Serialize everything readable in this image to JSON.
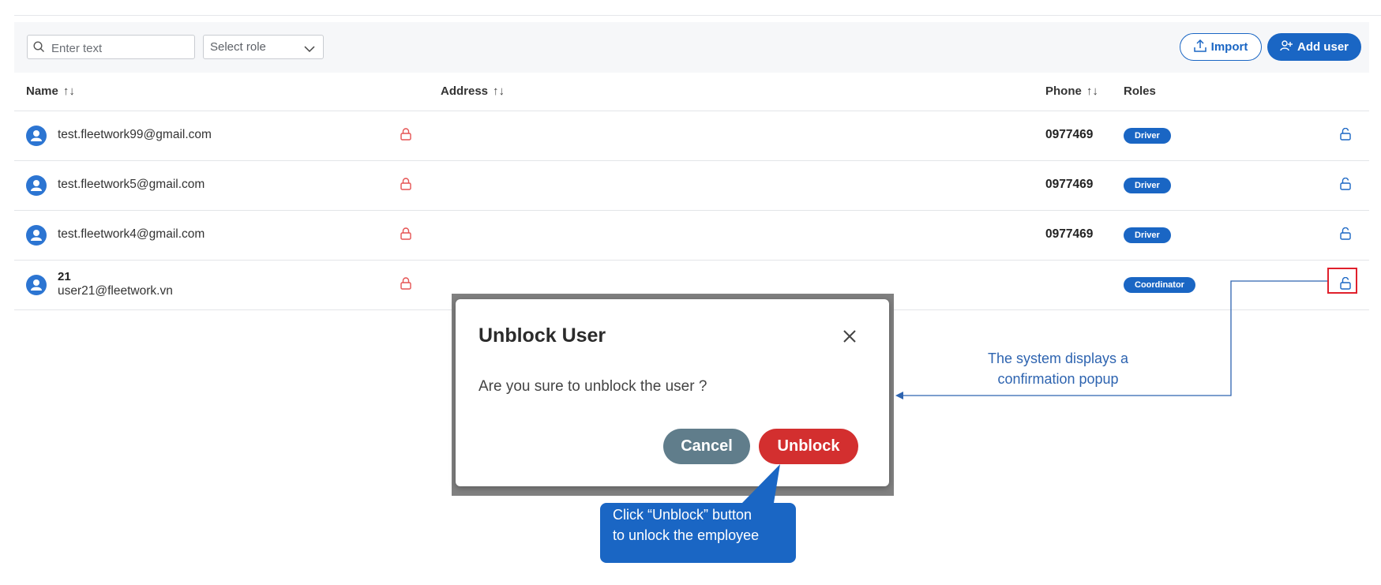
{
  "toolbar": {
    "search_placeholder": "Enter text",
    "select_role": "Select role",
    "import_label": "Import",
    "add_user_label": "Add user"
  },
  "table": {
    "headers": {
      "name": "Name",
      "address": "Address",
      "phone": "Phone",
      "roles": "Roles",
      "sort_glyph": "↑↓"
    },
    "rows": [
      {
        "email": "test.fleetwork99@gmail.com",
        "phone": "0977469",
        "role": "Driver"
      },
      {
        "email": "test.fleetwork5@gmail.com",
        "phone": "0977469",
        "role": "Driver"
      },
      {
        "email": "test.fleetwork4@gmail.com",
        "phone": "0977469",
        "role": "Driver"
      },
      {
        "name": "21",
        "email": "user21@fleetwork.vn",
        "phone": "",
        "role": "Coordinator"
      }
    ]
  },
  "modal": {
    "title": "Unblock User",
    "message": "Are you sure to unblock the user ?",
    "cancel_label": "Cancel",
    "unblock_label": "Unblock"
  },
  "annotations": {
    "callout_line1": "Click “Unblock” button",
    "callout_line2": "to unlock the employee",
    "system_line1": "The system displays a",
    "system_line2": "confirmation popup"
  },
  "colors": {
    "primary": "#1a66c4",
    "danger": "#d32f2f",
    "lock_red": "#e55353",
    "cancel": "#607d8b",
    "highlight": "#e0202c"
  }
}
